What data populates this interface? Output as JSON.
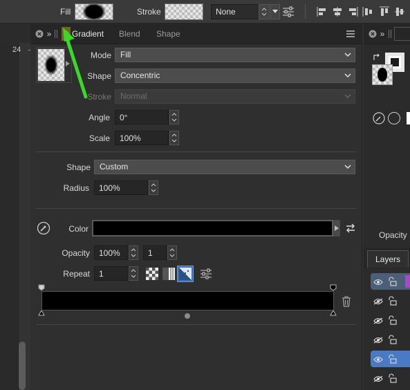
{
  "toolbar": {
    "fill_label": "Fill",
    "stroke_label": "Stroke",
    "stroke_style_value": "None"
  },
  "tabs": [
    {
      "label": "Gradient",
      "active": true
    },
    {
      "label": "Blend",
      "active": false
    },
    {
      "label": "Shape",
      "active": false
    }
  ],
  "gradient": {
    "mode_label": "Mode",
    "mode_value": "Fill",
    "shape_label": "Shape",
    "shape_value": "Concentric",
    "stroke_label": "Stroke",
    "stroke_value": "Normal",
    "angle_label": "Angle",
    "angle_value": "0°",
    "scale_label": "Scale",
    "scale_value": "100%"
  },
  "shape_section": {
    "shape_label": "Shape",
    "shape_value": "Custom",
    "radius_label": "Radius",
    "radius_value": "100%"
  },
  "color_section": {
    "color_label": "Color",
    "color_value": "#000000",
    "opacity_label": "Opacity",
    "opacity_value": "100%",
    "opacity_step": "1",
    "repeat_label": "Repeat",
    "repeat_value": "1"
  },
  "right_panel": {
    "opacity_label": "Opacity",
    "layers_tab": "Layers",
    "layer_count": 6,
    "selected_layer_index": 4
  },
  "ruler_label": "24",
  "colors": {
    "accent_blue": "#3f6fb5",
    "selected_layer": "#4a7ac4",
    "purple_swatch": "#a24dc8",
    "annotation_arrow": "#3ed62a",
    "highlight_box": "#6b6a1a"
  }
}
